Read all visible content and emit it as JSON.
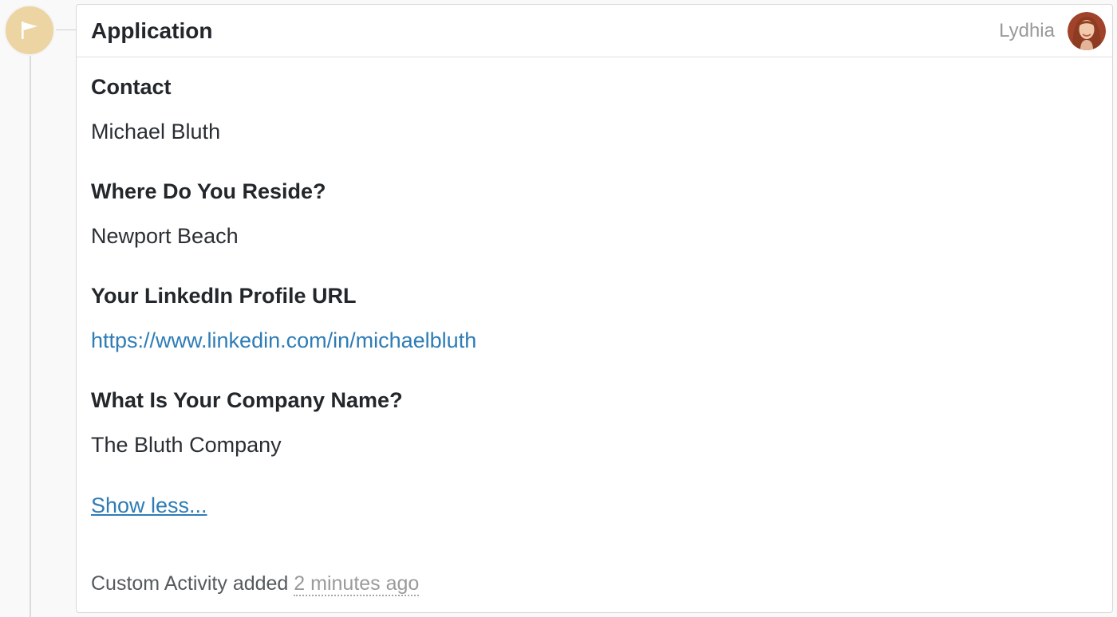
{
  "card": {
    "title": "Application",
    "user_name": "Lydhia",
    "marker_icon": "flag-icon"
  },
  "fields": [
    {
      "label": "Contact",
      "value": "Michael Bluth",
      "is_link": false
    },
    {
      "label": "Where Do You Reside?",
      "value": "Newport Beach",
      "is_link": false
    },
    {
      "label": "Your LinkedIn Profile URL",
      "value": "https://www.linkedin.com/in/michaelbluth",
      "is_link": true
    },
    {
      "label": "What Is Your Company Name?",
      "value": "The Bluth Company",
      "is_link": false
    }
  ],
  "toggle": {
    "label": "Show less..."
  },
  "footer": {
    "prefix": "Custom Activity added",
    "time": "2 minutes ago"
  },
  "colors": {
    "marker": "#ecd4a3",
    "link": "#2e7cb6",
    "muted": "#9a9a9a"
  }
}
